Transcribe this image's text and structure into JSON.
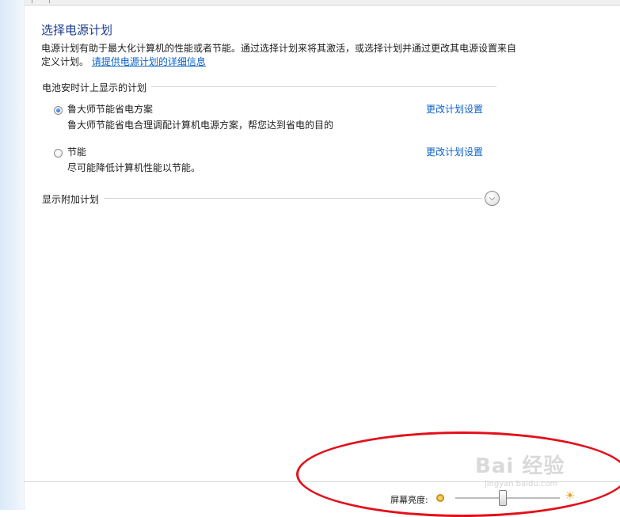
{
  "header": {
    "title": "选择电源计划",
    "description": "电源计划有助于最大化计算机的性能或者节能。通过选择计划来将其激活，或选择计划并通过更改其电源设置来自定义计划。",
    "details_link": "请提供电源计划的详细信息"
  },
  "battery_section": {
    "label": "电池安时计上显示的计划",
    "plans": [
      {
        "name": "鲁大师节能省电方案",
        "desc": "鲁大师节能省电合理调配计算机电源方案，帮您达到省电的目的",
        "selected": true,
        "change_link": "更改计划设置"
      },
      {
        "name": "节能",
        "desc": "尽可能降低计算机性能以节能。",
        "selected": false,
        "change_link": "更改计划设置"
      }
    ]
  },
  "extra_plans": {
    "label": "显示附加计划",
    "icon": "chevron-down-icon"
  },
  "footer": {
    "brightness_label": "屏幕亮度:",
    "brightness_value": 0.45,
    "dim_icon": "sun-dim-icon",
    "bright_icon": "sun-bright-icon"
  },
  "annotation": {
    "color": "#e3101b"
  },
  "watermark": {
    "text": "Bai 经验",
    "sub": "jingyan.baidu.com"
  }
}
